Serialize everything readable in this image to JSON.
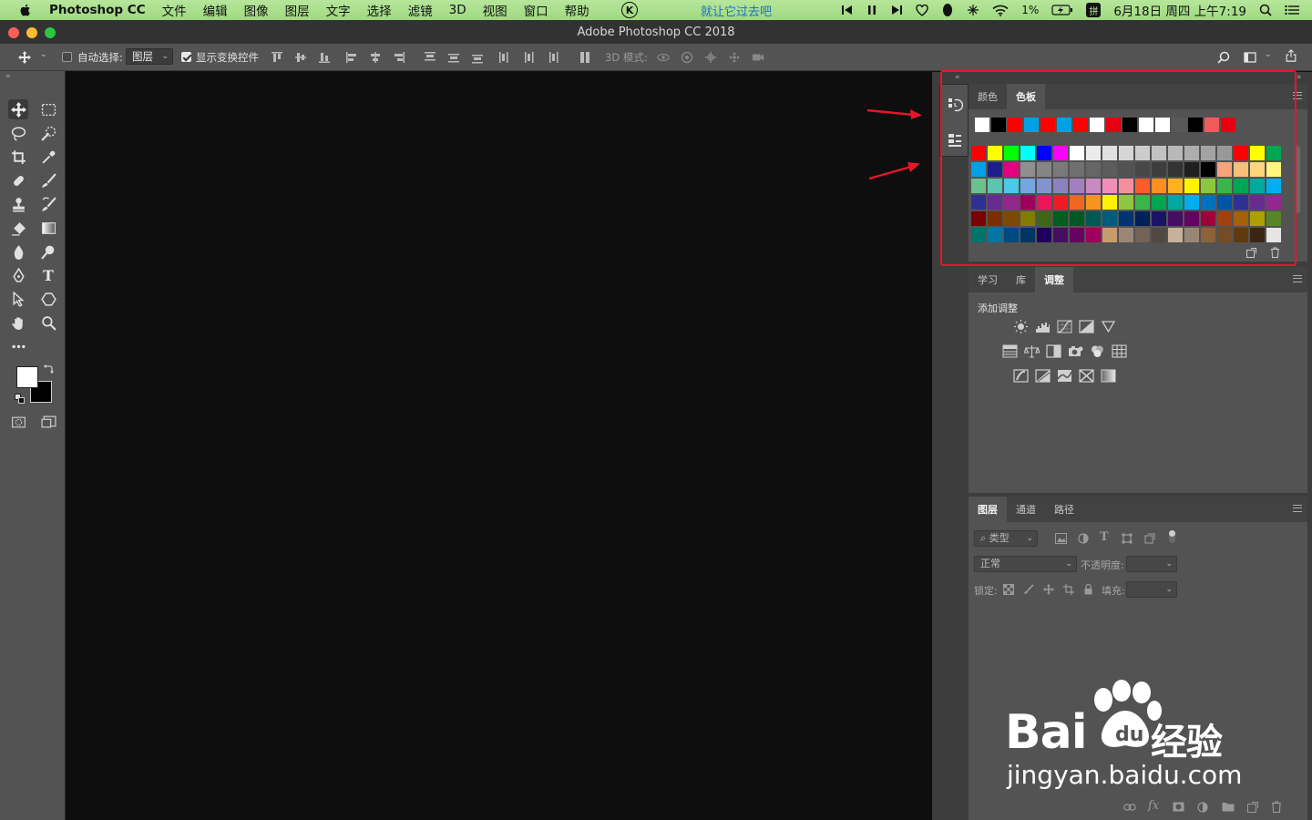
{
  "menubar": {
    "app_name": "Photoshop CC",
    "menus": [
      "文件",
      "编辑",
      "图像",
      "图层",
      "文字",
      "选择",
      "滤镜",
      "3D",
      "视图",
      "窗口",
      "帮助"
    ],
    "k_icon_label": "K",
    "now_playing": "就让它过去吧",
    "battery_percent": "1%",
    "input_method": "拼",
    "datetime": "6月18日 周四 上午7:19"
  },
  "window": {
    "title": "Adobe Photoshop CC 2018"
  },
  "options_bar": {
    "auto_select_label": "自动选择:",
    "auto_select_value": "图层",
    "show_transform_label": "显示变换控件",
    "mode_3d_label": "3D 模式:"
  },
  "swatches_panel": {
    "tabs": [
      "颜色",
      "色板"
    ],
    "active_tab": "色板",
    "recent_colors": [
      "#ffffff",
      "#000000",
      "#ff0000",
      "#00a0e9",
      "#ff0000",
      "#00a0e9",
      "#ff0000",
      "#ffffff",
      "#e60012",
      "#000000",
      "#ffffff",
      "#ffffff",
      "#595757",
      "#000000",
      "#f15b5b",
      "#e60012"
    ],
    "grid_rows": [
      [
        "#ff0000",
        "#ffff00",
        "#00ff00",
        "#00ffff",
        "#0000ff",
        "#ff00ff",
        "#ffffff",
        "#ebebeb",
        "#e0e0e0",
        "#d6d6d6",
        "#cccccc",
        "#c2c2c2",
        "#b8b8b8",
        "#adadad",
        "#a3a3a3",
        "#999999",
        "#ff0000",
        "#ffff00",
        "#00a651"
      ],
      [
        "#00a0e9",
        "#1d2088",
        "#e4007f",
        "#8f8f8f",
        "#858585",
        "#7a7a7a",
        "#707070",
        "#666666",
        "#5c5c5c",
        "#525252",
        "#474747",
        "#3d3d3d",
        "#333333",
        "#1f1f1f",
        "#000000",
        "#f7a37b",
        "#fabe7b",
        "#fdd57a",
        "#fff57f",
        "#c5e08d",
        "#9ed08d"
      ],
      [
        "#6cc08d",
        "#5ac4b1",
        "#4ec8e8",
        "#72a7e1",
        "#8393ce",
        "#8c82c0",
        "#a37fbf",
        "#ca89c1",
        "#f08eb8",
        "#f38f9e",
        "#ff5a2c",
        "#ff8f1f",
        "#ffb11f",
        "#fff200",
        "#8dc63f",
        "#39b54a",
        "#00a651",
        "#00a99d",
        "#00aeef",
        "#0072bc",
        "#0054a6"
      ],
      [
        "#2e3192",
        "#662d91",
        "#92278f",
        "#9e005d",
        "#ed145b",
        "#ed1c24",
        "#f26522",
        "#f7941d",
        "#fff200",
        "#8dc73f",
        "#39b54a",
        "#00a651",
        "#00a99d",
        "#00aeef",
        "#0072bc",
        "#0054a6",
        "#2e3192",
        "#662d91",
        "#92278f",
        "#9e005d",
        "#ed145b"
      ],
      [
        "#790000",
        "#7b2e00",
        "#7d4900",
        "#827b00",
        "#406618",
        "#005e20",
        "#005826",
        "#005952",
        "#005b7f",
        "#003471",
        "#002157",
        "#1b1464",
        "#440e62",
        "#630460",
        "#9e0039",
        "#a0410d",
        "#a36209",
        "#aba000",
        "#588528",
        "#197b30",
        "#007236"
      ],
      [
        "#00746b",
        "#0076a3",
        "#004a80",
        "#003663",
        "#21005d",
        "#450e61",
        "#630460",
        "#9e005d",
        "#c69c6d",
        "#998675",
        "#736357",
        "#534741",
        "#c7b299",
        "#998675",
        "#8c6239",
        "#754c24",
        "#603913",
        "#3c2415",
        "#e5e5e5",
        "#262626",
        "#9e0b0f"
      ]
    ]
  },
  "learn_panel": {
    "tabs": [
      "学习",
      "库",
      "调整"
    ],
    "active_tab": "调整",
    "add_adjustment_label": "添加调整"
  },
  "layers_panel": {
    "tabs": [
      "图层",
      "通道",
      "路径"
    ],
    "active_tab": "图层",
    "filter_placeholder": "类型",
    "blend_mode": "正常",
    "opacity_label": "不透明度:",
    "lock_label": "锁定:",
    "fill_label": "填充:"
  },
  "watermark": {
    "brand": "Bai",
    "brand_suffix": "经验",
    "url": "jingyan.baidu.com"
  },
  "colors": {
    "annotation_red": "#e5162a",
    "fg_color": "#ffffff",
    "bg_color": "#000000"
  }
}
